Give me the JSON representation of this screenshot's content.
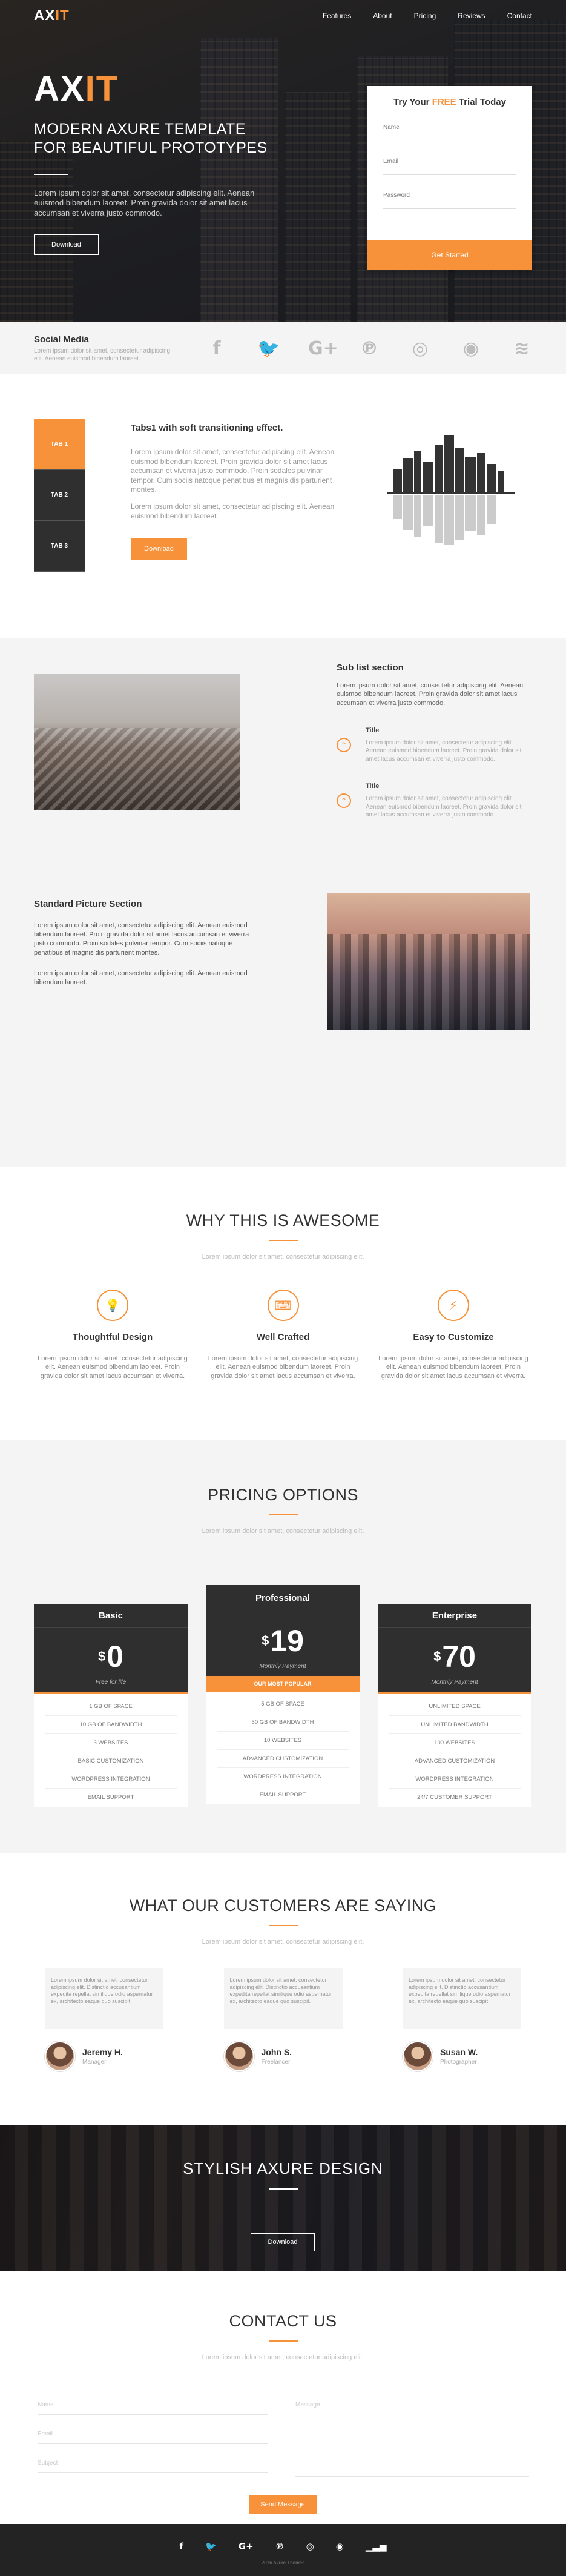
{
  "nav": {
    "logo_main": "AX",
    "logo_accent": "IT",
    "links": [
      "Features",
      "About",
      "Pricing",
      "Reviews",
      "Contact"
    ]
  },
  "hero": {
    "title_main": "AX",
    "title_accent": "IT",
    "subtitle_line1": "MODERN AXURE TEMPLATE",
    "subtitle_line2": "FOR BEAUTIFUL PROTOTYPES",
    "paragraph": "Lorem ipsum dolor sit amet, consectetur adipiscing elit. Aenean euismod bibendum laoreet. Proin gravida dolor sit amet lacus accumsan et viverra justo commodo.",
    "download_label": "Download"
  },
  "trial": {
    "title_pre": "Try Your ",
    "title_accent": "FREE",
    "title_post": " Trial Today",
    "name_placeholder": "Name",
    "email_placeholder": "Email",
    "password_placeholder": "Password",
    "submit_label": "Get Started"
  },
  "social": {
    "title": "Social Media",
    "desc": "Lorem ipsum dolor sit amet, consectetur adipiscing elit. Aenean euismod bibendum laoreet.",
    "icons": [
      {
        "name": "facebook-icon",
        "glyph": "f"
      },
      {
        "name": "twitter-icon",
        "glyph": "🐦"
      },
      {
        "name": "google-plus-icon",
        "glyph": "G+"
      },
      {
        "name": "pinterest-icon",
        "glyph": "℗"
      },
      {
        "name": "instagram-icon",
        "glyph": "◎"
      },
      {
        "name": "github-icon",
        "glyph": "◉"
      },
      {
        "name": "wifi-icon",
        "glyph": "≋"
      }
    ]
  },
  "tabs": {
    "items": [
      "TAB 1",
      "TAB 2",
      "TAB 3"
    ],
    "title": "Tabs1 with soft transitioning effect.",
    "para1": "Lorem ipsum dolor sit amet, consectetur adipiscing elit. Aenean euismod bibendum laoreet. Proin gravida dolor sit amet lacus accumsan et viverra justo commodo. Proin sodales pulvinar tempor. Cum sociis natoque penatibus et magnis dis parturient montes.",
    "para2": "Lorem ipsum dolor sit amet, consectetur adipiscing elit. Aenean euismod bibendum laoreet.",
    "download_label": "Download"
  },
  "sublist": {
    "title": "Sub list section",
    "desc": "Lorem ipsum dolor sit amet, consectetur adipiscing elit. Aenean euismod bibendum laoreet. Proin gravida dolor sit amet lacus accumsan et viverra justo commodo.",
    "items": [
      {
        "title": "Title",
        "desc": "Lorem ipsum dolor sit amet, consectetur adipiscing elit. Aenean euismod bibendum laoreet. Proin gravida dolor sit amet lacus accumsan et viverra justo commodo."
      },
      {
        "title": "Title",
        "desc": "Lorem ipsum dolor sit amet, consectetur adipiscing elit. Aenean euismod bibendum laoreet. Proin gravida dolor sit amet lacus accumsan et viverra justo commodo."
      }
    ]
  },
  "standard": {
    "title": "Standard Picture Section",
    "para1": "Lorem ipsum dolor sit amet, consectetur adipiscing elit. Aenean euismod bibendum laoreet. Proin gravida dolor sit amet lacus accumsan et viverra justo commodo. Proin sodales pulvinar tempor. Cum sociis natoque penatibus et magnis dis parturient montes.",
    "para2": "Lorem ipsum dolor sit amet, consectetur adipiscing elit. Aenean euismod bibendum laoreet."
  },
  "why": {
    "title": "WHY THIS IS AWESOME",
    "subtitle": "Lorem ipsum dolor sit amet, consectetur adipiscing elit.",
    "features": [
      {
        "icon": "lightbulb-icon",
        "glyph": "💡",
        "title": "Thoughtful Design",
        "desc": "Lorem ipsum dolor sit amet, consectetur adipiscing elit. Aenean euismod bibendum laoreet. Proin gravida dolor sit amet lacus accumsan et viverra."
      },
      {
        "icon": "keyboard-icon",
        "glyph": "⌨",
        "title": "Well Crafted",
        "desc": "Lorem ipsum dolor sit amet, consectetur adipiscing elit. Aenean euismod bibendum laoreet. Proin gravida dolor sit amet lacus accumsan et viverra."
      },
      {
        "icon": "lightning-icon",
        "glyph": "⚡",
        "title": "Easy to Customize",
        "desc": "Lorem ipsum dolor sit amet, consectetur adipiscing elit. Aenean euismod bibendum laoreet. Proin gravida dolor sit amet lacus accumsan et viverra."
      }
    ]
  },
  "pricing": {
    "title": "PRICING OPTIONS",
    "subtitle": "Lorem ipsum dolor sit amet, consectetur adipiscing elit.",
    "plans": [
      {
        "name": "Basic",
        "currency": "$",
        "price": "0",
        "period": "Free for life",
        "features": [
          "1 GB OF SPACE",
          "10 GB OF BANDWIDTH",
          "3 WEBSITES",
          "BASIC CUSTOMIZATION",
          "WORDPRESS INTEGRATION",
          "EMAIL SUPPORT"
        ]
      },
      {
        "name": "Professional",
        "currency": "$",
        "price": "19",
        "period": "Monthly Payment",
        "badge": "OUR MOST POPULAR",
        "features": [
          "5 GB OF SPACE",
          "50 GB OF BANDWIDTH",
          "10 WEBSITES",
          "ADVANCED CUSTOMIZATION",
          "WORDPRESS INTEGRATION",
          "EMAIL SUPPORT"
        ]
      },
      {
        "name": "Enterprise",
        "currency": "$",
        "price": "70",
        "period": "Monthly Payment",
        "features": [
          "UNLIMITED SPACE",
          "UNLIMITED BANDWIDTH",
          "100 WEBSITES",
          "ADVANCED CUSTOMIZATION",
          "WORDPRESS INTEGRATION",
          "24/7 CUSTOMER SUPPORT"
        ]
      }
    ]
  },
  "testimonials": {
    "title": "WHAT OUR CUSTOMERS ARE SAYING",
    "subtitle": "Lorem ipsum dolor sit amet, consectetur adipiscing elit.",
    "items": [
      {
        "quote": "Lorem ipsum dolor sit amet, consectetur adipiscing elit. Distinctio accusantium expedita repellat similique odio aspernatur ex, architecto eaque quo suscipit.",
        "name": "Jeremy H.",
        "role": "Manager"
      },
      {
        "quote": "Lorem ipsum dolor sit amet, consectetur adipiscing elit. Distinctio accusantium expedita repellat similique odio aspernatur ex, architecto eaque quo suscipit.",
        "name": "John S.",
        "role": "Freelancer"
      },
      {
        "quote": "Lorem ipsum dolor sit amet, consectetur adipiscing elit. Distinctio accusantium expedita repellat similique odio aspernatur ex, architecto eaque quo suscipit.",
        "name": "Susan W.",
        "role": "Photographer"
      }
    ]
  },
  "cta": {
    "title": "STYLISH AXURE DESIGN",
    "button_label": "Download"
  },
  "contact": {
    "title": "CONTACT US",
    "subtitle": "Lorem ipsum dolor sit amet, consectetur adipiscing elit.",
    "name_placeholder": "Name",
    "email_placeholder": "Email",
    "subject_placeholder": "Subject",
    "message_placeholder": "Message",
    "send_label": "Send Message"
  },
  "footer": {
    "icons": [
      {
        "name": "facebook-icon",
        "glyph": "f"
      },
      {
        "name": "twitter-icon",
        "glyph": "🐦"
      },
      {
        "name": "google-plus-icon",
        "glyph": "G+"
      },
      {
        "name": "pinterest-icon",
        "glyph": "℗"
      },
      {
        "name": "instagram-icon",
        "glyph": "◎"
      },
      {
        "name": "github-icon",
        "glyph": "◉"
      },
      {
        "name": "stats-icon",
        "glyph": "▁▃▅"
      }
    ],
    "copyright": "2016 Axure Themes"
  },
  "colors": {
    "accent": "#f7923a",
    "dark": "#2f2f2f",
    "light_bg": "#f4f4f4"
  }
}
